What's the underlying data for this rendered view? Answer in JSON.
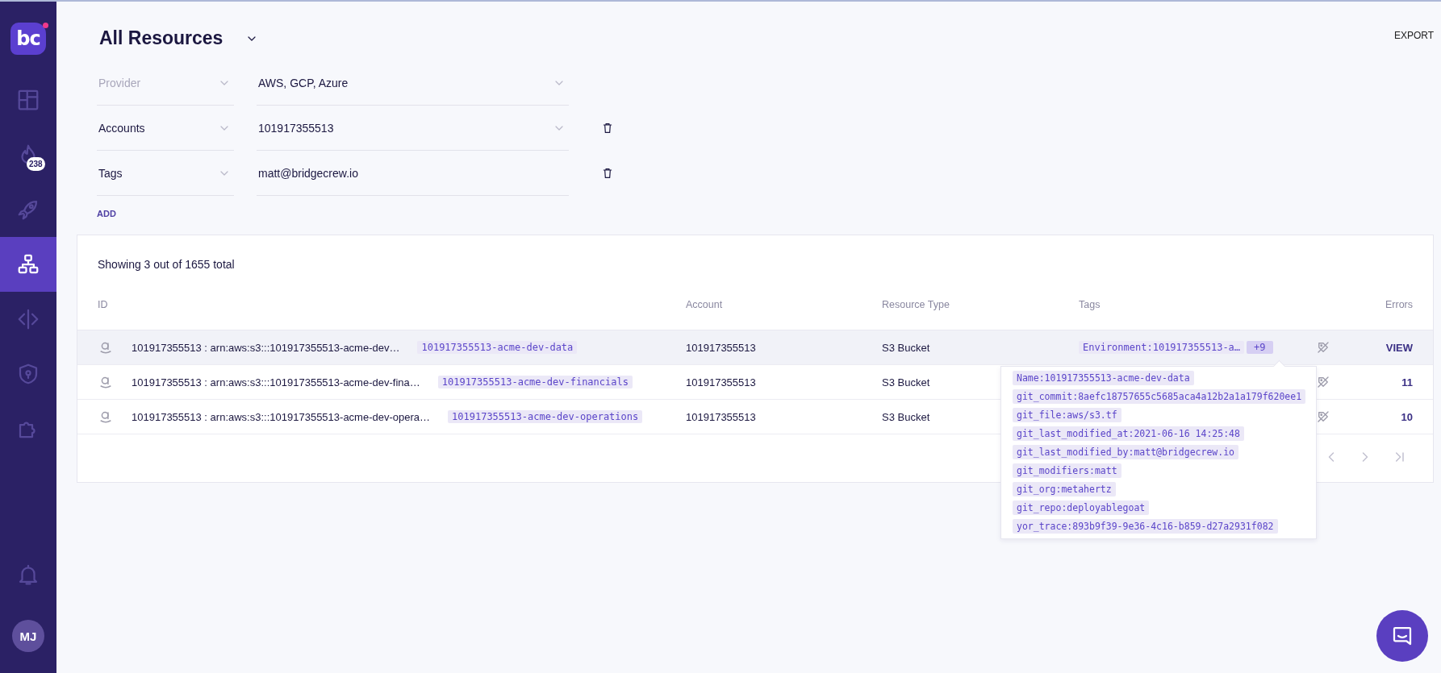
{
  "sidebar": {
    "logo": "bc",
    "nav": [
      {
        "kind": "dashboard",
        "selected": false
      },
      {
        "kind": "flame",
        "selected": false,
        "badge": "238"
      },
      {
        "kind": "rocket",
        "selected": false
      },
      {
        "kind": "hierarchy",
        "selected": true
      },
      {
        "kind": "code",
        "selected": false
      },
      {
        "kind": "shield",
        "selected": false
      },
      {
        "kind": "puzzle",
        "selected": false
      }
    ],
    "avatar": "MJ"
  },
  "header": {
    "title": "All Resources",
    "export": "EXPORT"
  },
  "filters": [
    {
      "kind": "select",
      "field": "Provider",
      "disabled": true,
      "value": "AWS, GCP, Azure",
      "removable": false
    },
    {
      "kind": "select",
      "field": "Accounts",
      "disabled": false,
      "value": "101917355513",
      "removable": true
    },
    {
      "kind": "text",
      "field": "Tags",
      "disabled": false,
      "value": "matt@bridgecrew.io",
      "removable": true
    }
  ],
  "add_button": "ADD",
  "table": {
    "summary": "Showing 3 out of 1655 total",
    "columns": [
      "ID",
      "Account",
      "Resource Type",
      "Tags",
      "Errors"
    ],
    "rows": [
      {
        "id": "101917355513 : arn:aws:s3:::101917355513-acme-dev…",
        "name": "101917355513-acme-dev-data",
        "account": "101917355513",
        "type": "S3 Bucket",
        "highlighted": true,
        "tag": "Environment:101917355513-a…",
        "more": "+9",
        "errors": "VIEW"
      },
      {
        "id": "101917355513 : arn:aws:s3:::101917355513-acme-dev-fina…",
        "name": "101917355513-acme-dev-financials",
        "account": "101917355513",
        "type": "S3 Bucket",
        "highlighted": false,
        "errors": "11"
      },
      {
        "id": "101917355513 : arn:aws:s3:::101917355513-acme-dev-opera…",
        "name": "101917355513-acme-dev-operations",
        "account": "101917355513",
        "type": "S3 Bucket",
        "highlighted": false,
        "errors": "10"
      }
    ]
  },
  "tags_popover": [
    "Name:101917355513-acme-dev-data",
    "git_commit:8aefc18757655c5685aca4a12b2a1a179f620ee1",
    "git_file:aws/s3.tf",
    "git_last_modified_at:2021-06-16 14:25:48",
    "git_last_modified_by:matt@bridgecrew.io",
    "git_modifiers:matt",
    "git_org:metahertz",
    "git_repo:deployablegoat",
    "yor_trace:893b9f39-9e36-4c16-b859-d27a2931f082"
  ]
}
